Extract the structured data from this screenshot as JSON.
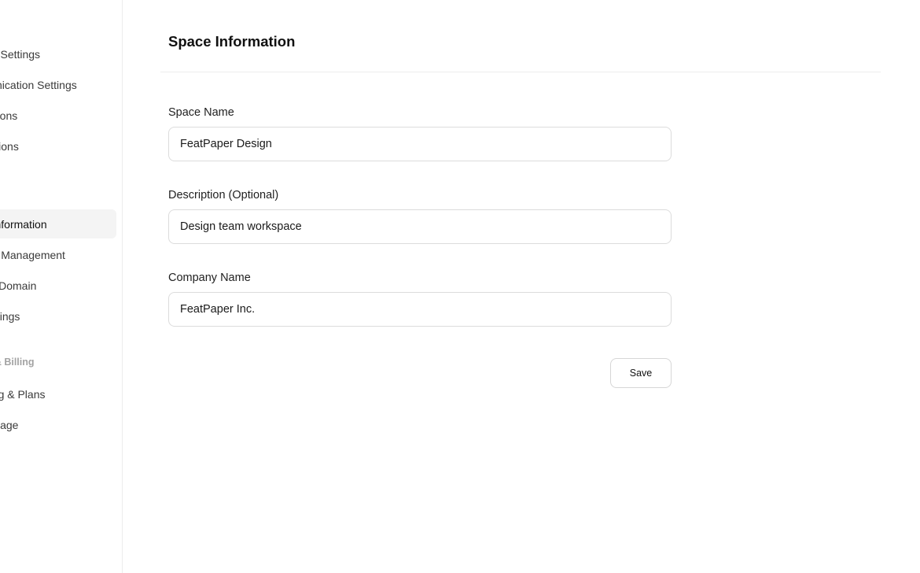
{
  "sidebar": {
    "items": [
      {
        "label": "Account Settings"
      },
      {
        "label": "Communication Settings"
      },
      {
        "label": "Notifications"
      },
      {
        "label": "Connections"
      },
      {
        "label": "Space Information"
      },
      {
        "label": "Member Management"
      },
      {
        "label": "Custom Domain"
      },
      {
        "label": "App Settings"
      },
      {
        "label": "Billing & Plans"
      },
      {
        "label": "Usage"
      }
    ],
    "section_heading": "Plans & Billing",
    "active_item": "Space Information"
  },
  "main": {
    "title": "Space Information",
    "fields": [
      {
        "label": "Space Name",
        "value": "FeatPaper Design"
      },
      {
        "label": "Description (Optional)",
        "value": "Design team workspace"
      },
      {
        "label": "Company Name",
        "value": "FeatPaper Inc."
      }
    ],
    "save_label": "Save"
  }
}
